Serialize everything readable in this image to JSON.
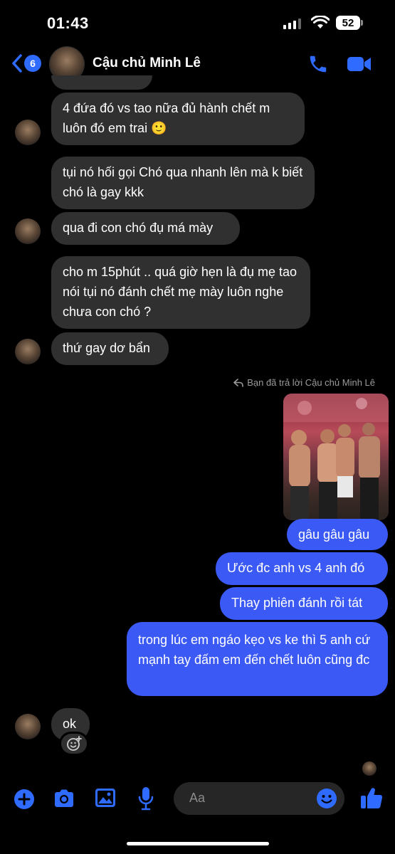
{
  "status_bar": {
    "time": "01:43",
    "battery": "52"
  },
  "header": {
    "back_count": "6",
    "contact_name": "Cậu chủ Minh Lê"
  },
  "messages": [
    {
      "from": "them",
      "text": "4 đứa đó vs tao nữa đủ hành chết m luôn đó em trai 🙂"
    },
    {
      "from": "them",
      "text": "tụi nó hối gọi Chó qua nhanh lên mà k biết chó là gay kkk"
    },
    {
      "from": "them",
      "text": "qua đi con chó đụ má mày"
    },
    {
      "from": "them",
      "text": "cho m 15phút .. quá giờ hẹn là đụ mẹ tao nói tụi nó đánh chết mẹ mày luôn nghe chưa con chó ?"
    },
    {
      "from": "them",
      "text": "thứ gay dơ bẩn"
    },
    {
      "from": "me",
      "text": "gâu gâu gâu"
    },
    {
      "from": "me",
      "text": "Ước đc anh vs 4 anh đó"
    },
    {
      "from": "me",
      "text": "Thay phiên đánh rồi tát"
    },
    {
      "from": "me",
      "text": "trong lúc em ngáo kẹo vs ke thì 5 anh cứ mạnh tay đấm em đến chết luôn cũng đc"
    },
    {
      "from": "them",
      "text": "ok"
    }
  ],
  "reply_note": "Bạn đã trả lời Cậu chủ Minh Lê",
  "composer": {
    "placeholder": "Aa"
  },
  "colors": {
    "accent": "#2f6bff",
    "out_bubble": "#3b59f5",
    "in_bubble": "#303030"
  }
}
